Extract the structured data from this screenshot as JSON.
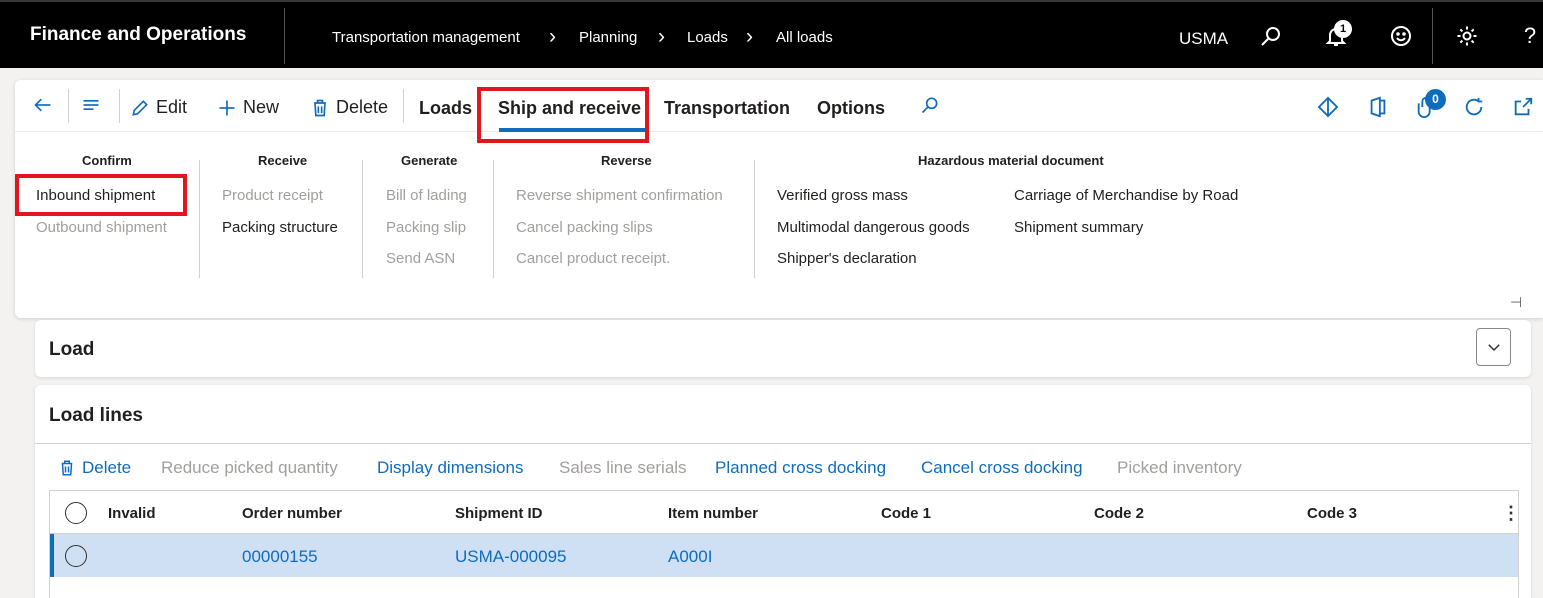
{
  "topbar": {
    "app_title": "Finance and Operations",
    "breadcrumbs": [
      "Transportation management",
      "Planning",
      "Loads",
      "All loads"
    ],
    "company": "USMA",
    "notification_count": "1",
    "icons": [
      "search-icon",
      "bell-icon",
      "smiley-icon",
      "gear-icon",
      "help-icon"
    ]
  },
  "action_pane": {
    "buttons": {
      "edit": "Edit",
      "new": "New",
      "delete": "Delete"
    },
    "tabs": [
      "Loads",
      "Ship and receive",
      "Transportation",
      "Options"
    ],
    "active_tab": "Ship and receive",
    "attachment_count": "0",
    "groups": {
      "confirm": {
        "title": "Confirm",
        "items": [
          {
            "label": "Inbound shipment",
            "enabled": true
          },
          {
            "label": "Outbound shipment",
            "enabled": false
          }
        ]
      },
      "receive": {
        "title": "Receive",
        "items": [
          {
            "label": "Product receipt",
            "enabled": false
          },
          {
            "label": "Packing structure",
            "enabled": true
          }
        ]
      },
      "generate": {
        "title": "Generate",
        "items": [
          {
            "label": "Bill of lading",
            "enabled": false
          },
          {
            "label": "Packing slip",
            "enabled": false
          },
          {
            "label": "Send ASN",
            "enabled": false
          }
        ]
      },
      "reverse": {
        "title": "Reverse",
        "items": [
          {
            "label": "Reverse shipment confirmation",
            "enabled": false
          },
          {
            "label": "Cancel packing slips",
            "enabled": false
          },
          {
            "label": "Cancel product receipt.",
            "enabled": false
          }
        ]
      },
      "hazardous": {
        "title": "Hazardous material document",
        "items": [
          {
            "label": "Verified gross mass",
            "enabled": true
          },
          {
            "label": "Multimodal dangerous goods",
            "enabled": true
          },
          {
            "label": "Shipper's declaration",
            "enabled": true
          },
          {
            "label": "Carriage of Merchandise by Road",
            "enabled": true
          },
          {
            "label": "Shipment summary",
            "enabled": true
          }
        ]
      }
    }
  },
  "load_section": {
    "title": "Load"
  },
  "load_lines": {
    "title": "Load lines",
    "actions": [
      {
        "label": "Delete",
        "enabled": true
      },
      {
        "label": "Reduce picked quantity",
        "enabled": false
      },
      {
        "label": "Display dimensions",
        "enabled": true
      },
      {
        "label": "Sales line serials",
        "enabled": false
      },
      {
        "label": "Planned cross docking",
        "enabled": true
      },
      {
        "label": "Cancel cross docking",
        "enabled": true
      },
      {
        "label": "Picked inventory",
        "enabled": false
      }
    ],
    "columns": [
      "Invalid",
      "Order number",
      "Shipment ID",
      "Item number",
      "Code 1",
      "Code 2",
      "Code 3"
    ],
    "rows": [
      {
        "invalid": "",
        "order_number": "00000155",
        "shipment_id": "USMA-000095",
        "item_number": "A000I",
        "code1": "",
        "code2": "",
        "code3": ""
      }
    ]
  },
  "colors": {
    "accent": "#0f6cbd",
    "highlight": "#e3151f",
    "selected_row": "#cfe0f5",
    "topbar": "#000000"
  }
}
